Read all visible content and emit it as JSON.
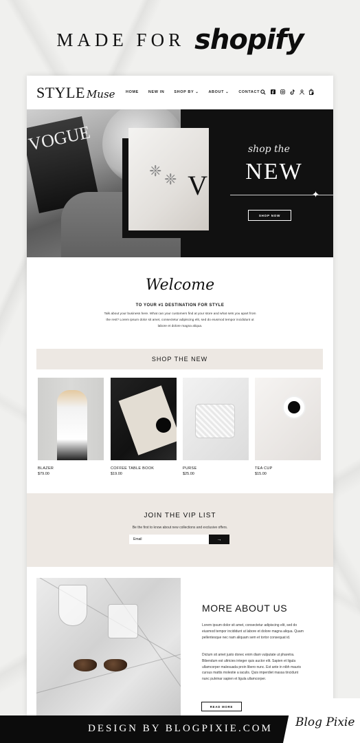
{
  "banner": {
    "made_for": "MADE FOR",
    "brand": "shopify"
  },
  "site": {
    "logo": {
      "main": "STYLE",
      "script": "Muse"
    },
    "nav": {
      "items": [
        "HOME",
        "NEW IN",
        "SHOP BY ⌄",
        "ABOUT ⌄",
        "CONTACT"
      ],
      "icons": [
        "search-icon",
        "facebook-icon",
        "instagram-icon",
        "tiktok-icon",
        "account-icon",
        "cart-icon"
      ]
    },
    "hero": {
      "script": "shop the",
      "title": "NEW",
      "button": "SHOP NOW"
    },
    "welcome": {
      "script": "Welcome",
      "subtitle": "TO YOUR #1 DESTINATION FOR STYLE",
      "body": "Talk about your business here. What can your customers find at your store and what sets you apart from the rest? Lorem ipsum dolor sit amet, consectetur adipiscing elit, sed do eiusmod tempor incididunt ut labore et dolore magna aliqua."
    },
    "shop_band": "SHOP THE NEW",
    "products": [
      {
        "name": "BLAZER",
        "price": "$79.00"
      },
      {
        "name": "COFFEE TABLE BOOK",
        "price": "$19.00"
      },
      {
        "name": "PURSE",
        "price": "$25.00"
      },
      {
        "name": "TEA CUP",
        "price": "$15.00"
      }
    ],
    "vip": {
      "title": "JOIN THE VIP LIST",
      "subtitle": "Be the first to know about new collections and exclusive offers.",
      "email_placeholder": "Email",
      "submit": "→"
    },
    "about": {
      "title": "MORE ABOUT US",
      "p1": "Lorem ipsum dolor sit amet, consectetur adipiscing elit, sed do eiusmod tempor incididunt ut labore et dolore magna aliqua. Quam pellentesque nec nam aliquam sem et tortor consequat id.",
      "p2": "Dictum sit amet justo donec enim diam vulputate ut pharetra. Bibendum est ultricies integer quis auctor elit. Sapien et ligula ullamcorper malesuada proin libero nunc. Est ante in nibh mauris cursus mattis molestie a iaculis. Quis imperdiet massa tincidunt nunc pulvinar sapien et ligula ullamcorper.",
      "button": "READ MORE"
    }
  },
  "footer": {
    "text": "DESIGN BY BLOGPIXIE.COM",
    "badge": "Blog Pixie"
  }
}
